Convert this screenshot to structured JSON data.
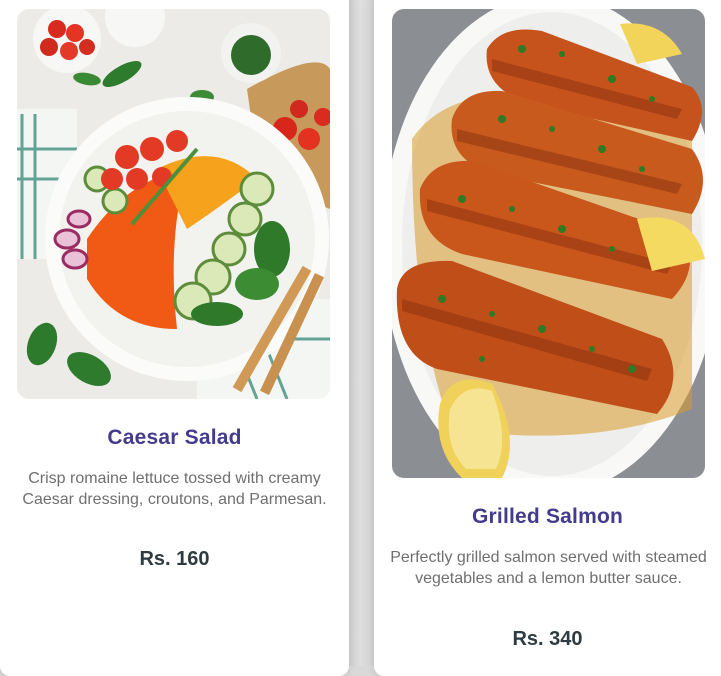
{
  "menu": {
    "items": [
      {
        "name": "Caesar Salad",
        "description": "Crisp romaine lettuce tossed with creamy Caesar dressing, croutons, and Parmesan.",
        "price": "Rs. 160"
      },
      {
        "name": "Grilled Salmon",
        "description": "Perfectly grilled salmon served with steamed vegetables and a lemon butter sauce.",
        "price": "Rs. 340"
      }
    ]
  }
}
